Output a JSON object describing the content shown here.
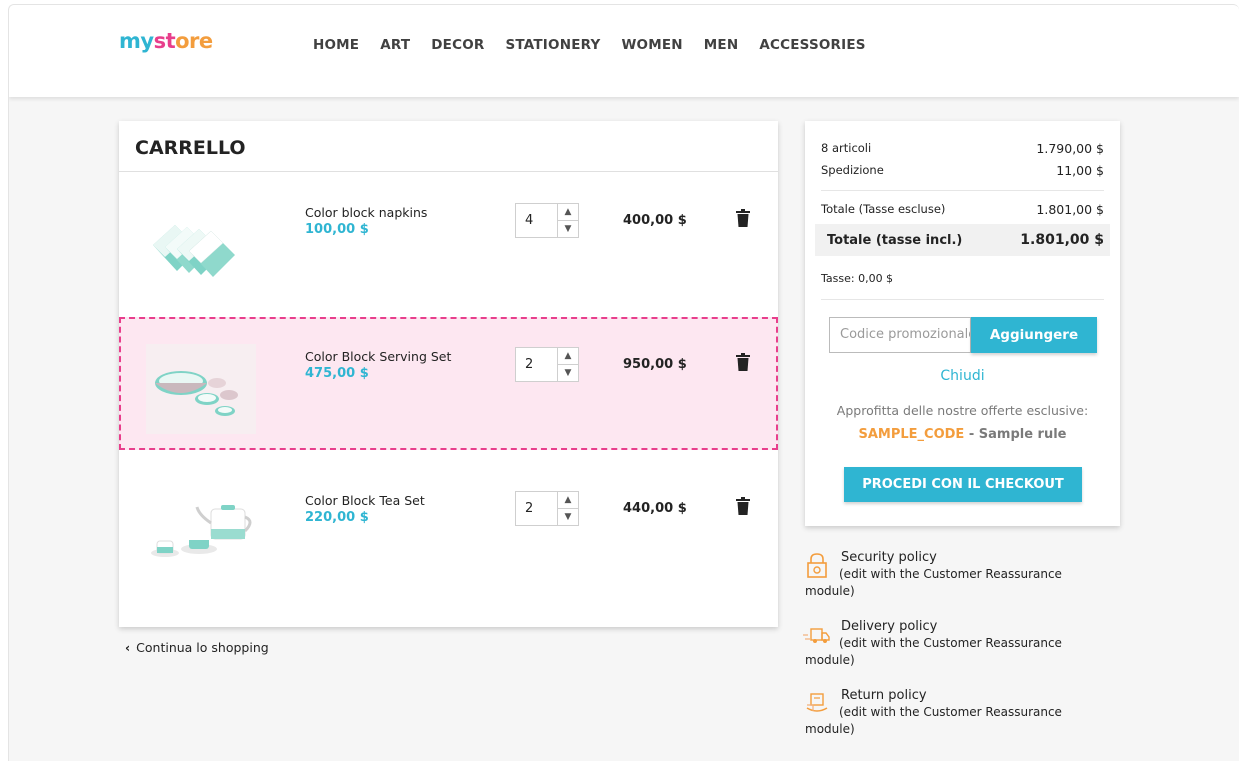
{
  "header": {
    "logo": {
      "part1": "my",
      "part2": "st",
      "part3": "ore"
    },
    "nav": [
      "HOME",
      "ART",
      "DECOR",
      "STATIONERY",
      "WOMEN",
      "MEN",
      "ACCESSORIES"
    ]
  },
  "cart": {
    "title": "CARRELLO",
    "items": [
      {
        "name": "Color block napkins",
        "unit_price": "100,00 $",
        "qty": "4",
        "total": "400,00 $",
        "image": "napkins"
      },
      {
        "name": "Color Block Serving Set",
        "unit_price": "475,00 $",
        "qty": "2",
        "total": "950,00 $",
        "image": "serving-set"
      },
      {
        "name": "Color Block Tea Set",
        "unit_price": "220,00 $",
        "qty": "2",
        "total": "440,00 $",
        "image": "tea-set"
      }
    ],
    "continue_label": "Continua lo shopping"
  },
  "summary": {
    "items_label": "8 articoli",
    "items_value": "1.790,00 $",
    "shipping_label": "Spedizione",
    "shipping_value": "11,00 $",
    "total_excl_label": "Totale (Tasse escluse)",
    "total_excl_value": "1.801,00 $",
    "total_incl_label": "Totale (tasse incl.)",
    "total_incl_value": "1.801,00 $",
    "taxes": "Tasse: 0,00 $",
    "promo_placeholder": "Codice promozionale",
    "promo_button": "Aggiungere",
    "close_link": "Chiudi",
    "offer_text": "Approfitta delle nostre offerte esclusive:",
    "offer_code": "SAMPLE_CODE",
    "offer_desc": "- Sample rule",
    "checkout_button": "PROCEDI CON IL CHECKOUT"
  },
  "reassurance": [
    {
      "title": "Security policy",
      "line2": "(edit with the Customer Reassurance",
      "line3": "module)",
      "icon": "lock-icon"
    },
    {
      "title": "Delivery policy",
      "line2": "(edit with the Customer Reassurance",
      "line3": "module)",
      "icon": "truck-icon"
    },
    {
      "title": "Return policy",
      "line2": "(edit with the Customer Reassurance",
      "line3": "module)",
      "icon": "return-box-icon"
    }
  ],
  "colors": {
    "accent": "#2fb5d2",
    "highlight_border": "#e83e8c",
    "highlight_bg": "#fde7f1",
    "promo_code": "#f39d3d"
  }
}
